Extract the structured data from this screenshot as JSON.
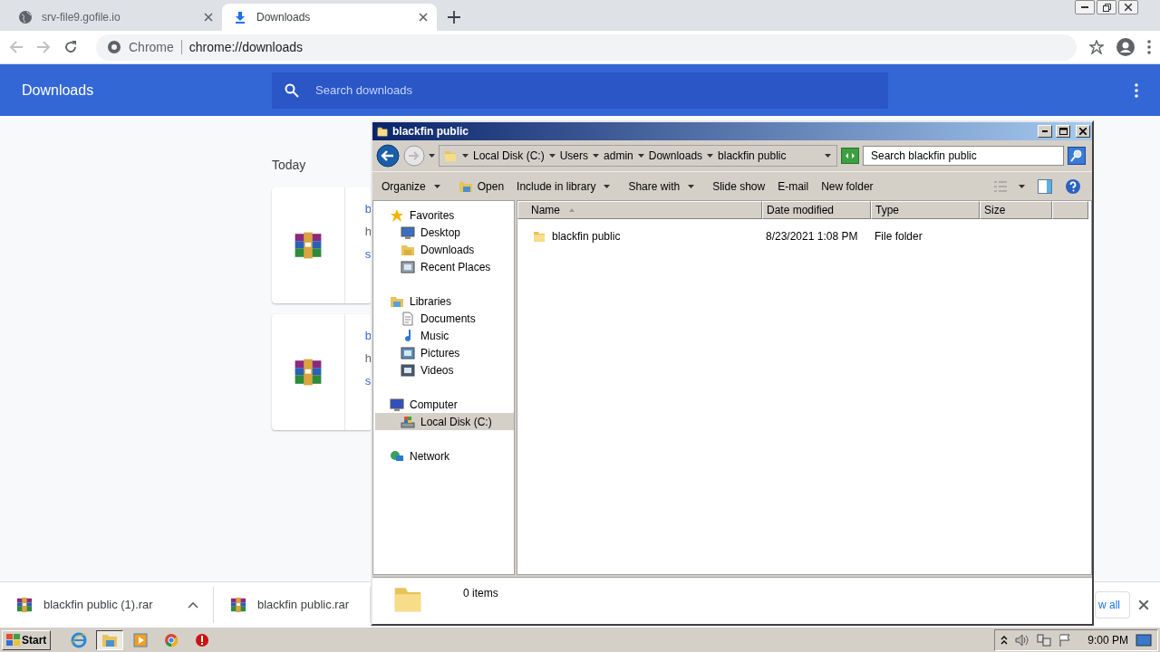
{
  "browser": {
    "tabs": [
      {
        "title": "srv-file9.gofile.io",
        "kind": "globe",
        "selected": false
      },
      {
        "title": "Downloads",
        "kind": "download",
        "selected": true
      }
    ],
    "omnibox": {
      "site": "Chrome",
      "url": "chrome://downloads"
    }
  },
  "downloads_page": {
    "title": "Downloads",
    "search": {
      "placeholder": "Search downloads"
    },
    "section": "Today",
    "cards": [
      {
        "line_1": "b",
        "line_2": "h",
        "line_3": "s"
      },
      {
        "line_1": "b",
        "line_2": "h",
        "line_3": "s"
      }
    ]
  },
  "shelf": {
    "items": [
      {
        "name": "blackfin public (1).rar",
        "menu": true
      },
      {
        "name": "blackfin public.rar",
        "menu": false
      }
    ],
    "show_all": "w all"
  },
  "explorer": {
    "title": "blackfin public",
    "breadcrumb": [
      "Local Disk (C:)",
      "Users",
      "admin",
      "Downloads",
      "blackfin public"
    ],
    "search": {
      "placeholder": "Search blackfin public"
    },
    "toolbar": [
      {
        "label": "Organize",
        "kind": "menu"
      },
      {
        "label": "Open",
        "kind": "icon"
      },
      {
        "label": "Include in library",
        "kind": "menu"
      },
      {
        "label": "Share with",
        "kind": "menu"
      },
      {
        "label": "Slide show",
        "kind": "plain"
      },
      {
        "label": "E-mail",
        "kind": "plain"
      },
      {
        "label": "New folder",
        "kind": "plain"
      }
    ],
    "nav": [
      {
        "label": "Favorites",
        "kind": "star",
        "selected": false,
        "children": [
          {
            "label": "Desktop",
            "kind": "desktop",
            "selected": false
          },
          {
            "label": "Downloads",
            "kind": "downloads",
            "selected": false
          },
          {
            "label": "Recent Places",
            "kind": "recent",
            "selected": false
          }
        ]
      },
      {
        "label": "Libraries",
        "kind": "library",
        "selected": false,
        "children": [
          {
            "label": "Documents",
            "kind": "document",
            "selected": false
          },
          {
            "label": "Music",
            "kind": "music",
            "selected": false
          },
          {
            "label": "Pictures",
            "kind": "pictures",
            "selected": false
          },
          {
            "label": "Videos",
            "kind": "videos",
            "selected": false
          }
        ]
      },
      {
        "label": "Computer",
        "kind": "computer",
        "selected": false,
        "children": [
          {
            "label": "Local Disk (C:)",
            "kind": "disk",
            "selected": true
          }
        ]
      },
      {
        "label": "Network",
        "kind": "network",
        "selected": false
      }
    ],
    "columns": [
      {
        "label": "Name",
        "sorted": true
      },
      {
        "label": "Date modified",
        "sorted": false
      },
      {
        "label": "Type",
        "sorted": false
      },
      {
        "label": "Size",
        "sorted": false
      }
    ],
    "rows": [
      {
        "name": "blackfin public",
        "date": "8/23/2021 1:08 PM",
        "type": "File folder"
      }
    ],
    "status": "0 items"
  },
  "taskbar": {
    "start": "Start",
    "apps": [
      {
        "kind": "ie",
        "selected": false
      },
      {
        "kind": "explorer",
        "selected": true
      },
      {
        "kind": "media",
        "selected": false
      },
      {
        "kind": "chrome",
        "selected": false
      },
      {
        "kind": "stop",
        "selected": false
      }
    ],
    "clock": "9:00 PM"
  }
}
